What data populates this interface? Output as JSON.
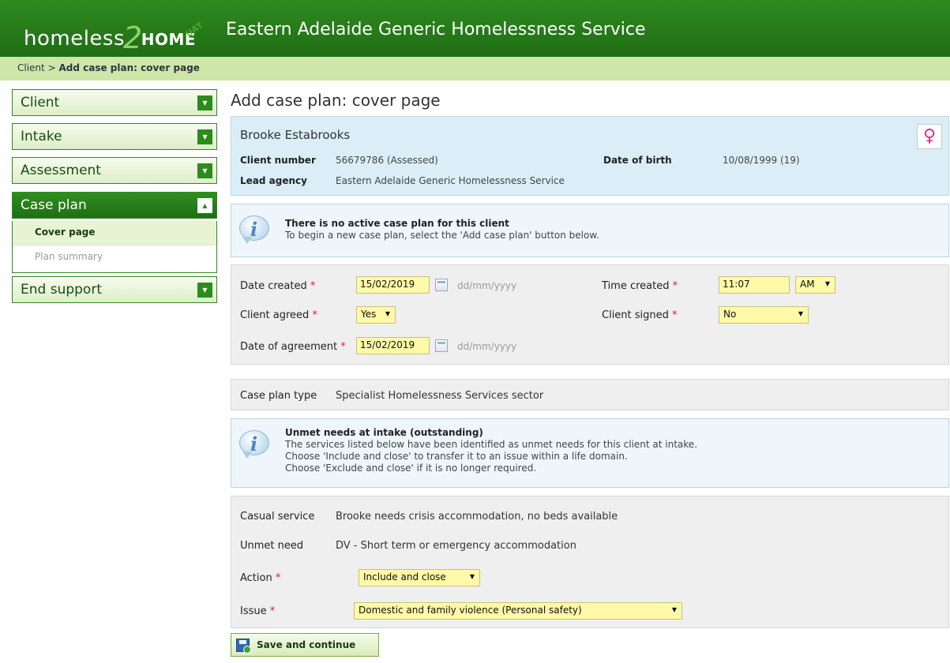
{
  "header": {
    "logo_part1": "homeless",
    "logo_two": "2",
    "logo_part2": "HOME",
    "logo_badge": "UAT",
    "service_title": "Eastern Adelaide Generic Homelessness Service"
  },
  "breadcrumb": {
    "parent": "Client",
    "separator": ">",
    "current": "Add case plan: cover page"
  },
  "sidebar": {
    "items": [
      {
        "label": "Client",
        "icon": "chevron-down-icon"
      },
      {
        "label": "Intake",
        "icon": "chevron-down-icon"
      },
      {
        "label": "Assessment",
        "icon": "chevron-down-icon"
      },
      {
        "label": "Case plan",
        "icon": "chevron-up-icon"
      },
      {
        "label": "End support",
        "icon": "chevron-down-icon"
      }
    ],
    "subitems": [
      {
        "label": "Cover page"
      },
      {
        "label": "Plan summary"
      }
    ]
  },
  "page_title": "Add case plan: cover page",
  "client": {
    "name": "Brooke Estabrooks",
    "gender_icon": "female-icon",
    "client_number_label": "Client number",
    "client_number": "56679786 (Assessed)",
    "dob_label": "Date of birth",
    "dob": "10/08/1999 (19)",
    "lead_agency_label": "Lead agency",
    "lead_agency": "Eastern Adelaide Generic Homelessness Service"
  },
  "notice1": {
    "title": "There is no active case plan for this client",
    "line1": "To begin a new case plan, select the 'Add case plan' button below."
  },
  "form": {
    "date_created_label": "Date created",
    "date_created": "15/02/2019",
    "date_hint": "dd/mm/yyyy",
    "time_created_label": "Time created",
    "time_created": "11:07",
    "ampm": "AM",
    "client_agreed_label": "Client agreed",
    "client_agreed": "Yes",
    "client_signed_label": "Client signed",
    "client_signed": "No",
    "date_agreement_label": "Date of agreement",
    "date_agreement": "15/02/2019",
    "required_mark": "*"
  },
  "case_plan_type": {
    "label": "Case plan type",
    "value": "Specialist Homelessness Services sector"
  },
  "notice2": {
    "title": "Unmet needs at intake (outstanding)",
    "line1": "The services listed below have been identified as unmet needs for this client at intake.",
    "line2": "Choose 'Include and close' to transfer it to an issue within a life domain.",
    "line3": "Choose 'Exclude and close' if it is no longer required."
  },
  "unmet": {
    "casual_label": "Casual service",
    "casual_value": "Brooke needs crisis accommodation, no beds available",
    "need_label": "Unmet need",
    "need_value": "DV - Short term or emergency accommodation",
    "action_label": "Action",
    "action_value": "Include and close",
    "issue_label": "Issue",
    "issue_value": "Domestic and family violence (Personal safety)"
  },
  "save_button": "Save and continue"
}
